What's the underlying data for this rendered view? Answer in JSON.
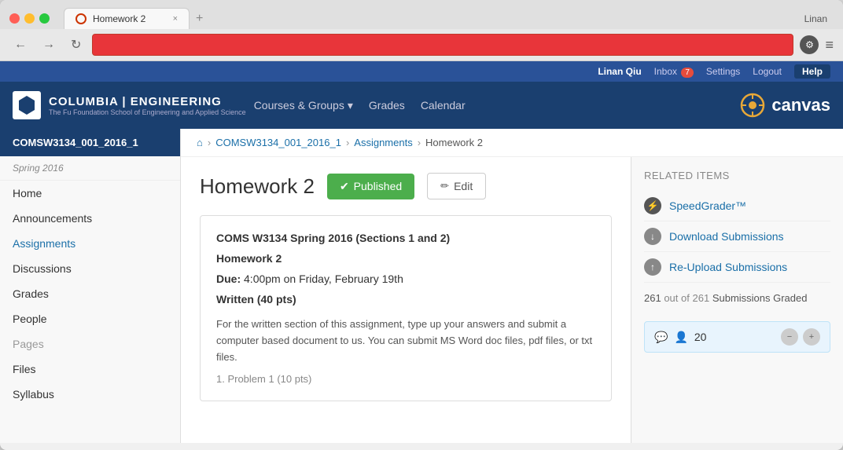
{
  "browser": {
    "tab_favicon": "canvas-favicon",
    "tab_title": "Homework 2",
    "tab_close": "×",
    "tab_new": "+",
    "user_label": "Linan",
    "back_btn": "←",
    "forward_btn": "→",
    "refresh_btn": "↻",
    "address_bar_value": "",
    "toolbar_icon": "⚙",
    "menu_icon": "≡"
  },
  "topnav": {
    "logo_alt": "Columbia Engineering",
    "logo_title": "COLUMBIA | ENGINEERING",
    "logo_subtitle": "The Fu Foundation School of Engineering and Applied Science",
    "nav_links": [
      {
        "label": "Courses & Groups",
        "dropdown": true
      },
      {
        "label": "Grades"
      },
      {
        "label": "Calendar"
      }
    ],
    "canvas_text": "canvas"
  },
  "userbar": {
    "user_name": "Linan Qiu",
    "inbox_label": "Inbox",
    "inbox_count": "7",
    "settings_label": "Settings",
    "logout_label": "Logout",
    "help_label": "Help"
  },
  "sidebar": {
    "course_id": "COMSW3134_001_2016_1",
    "semester": "Spring 2016",
    "items": [
      {
        "label": "Home",
        "active": false,
        "muted": false
      },
      {
        "label": "Announcements",
        "active": false,
        "muted": false
      },
      {
        "label": "Assignments",
        "active": true,
        "muted": false
      },
      {
        "label": "Discussions",
        "active": false,
        "muted": false
      },
      {
        "label": "Grades",
        "active": false,
        "muted": false
      },
      {
        "label": "People",
        "active": false,
        "muted": false
      },
      {
        "label": "Pages",
        "active": false,
        "muted": true
      },
      {
        "label": "Files",
        "active": false,
        "muted": false
      },
      {
        "label": "Syllabus",
        "active": false,
        "muted": false
      }
    ]
  },
  "breadcrumb": {
    "home_icon": "⌂",
    "course_link": "COMSW3134_001_2016_1",
    "section_link": "Assignments",
    "current": "Homework 2"
  },
  "main": {
    "page_title": "Homework 2",
    "btn_published": "Published",
    "btn_edit": "Edit",
    "assignment": {
      "course_name": "COMS W3134 Spring 2016 (Sections 1 and 2)",
      "hw_name": "Homework 2",
      "due_label": "Due:",
      "due_value": "4:00pm on Friday, February 19th",
      "pts_label": "Written (40 pts)",
      "description": "For the written section of this assignment, type up your answers and submit a computer based document to us. You can submit MS Word doc files, pdf files, or txt files.",
      "problem_hint": "1. Problem 1 (10 pts)"
    }
  },
  "right_panel": {
    "related_title": "Related Items",
    "items": [
      {
        "label": "SpeedGrader™",
        "icon_type": "speedgrader"
      },
      {
        "label": "Download Submissions",
        "icon_type": "download"
      },
      {
        "label": "Re-Upload Submissions",
        "icon_type": "reupload"
      }
    ],
    "graded_prefix": "261",
    "graded_out_of": "out of",
    "graded_total": "261",
    "graded_suffix": "Submissions Graded",
    "comment_count": "20",
    "action_minus": "−",
    "action_plus": "+"
  }
}
